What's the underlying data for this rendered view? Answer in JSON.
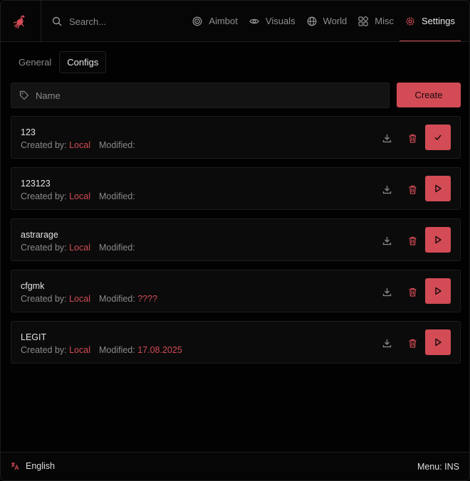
{
  "header": {
    "logo_icon": "crab-icon",
    "search_placeholder": "Search...",
    "nav": [
      {
        "label": "Aimbot",
        "icon": "target-icon"
      },
      {
        "label": "Visuals",
        "icon": "eye-icon"
      },
      {
        "label": "World",
        "icon": "globe-icon"
      },
      {
        "label": "Misc",
        "icon": "grid-icon"
      },
      {
        "label": "Settings",
        "icon": "gear-icon",
        "active": true
      }
    ]
  },
  "subtabs": [
    {
      "label": "General"
    },
    {
      "label": "Configs",
      "active": true
    }
  ],
  "name_input": {
    "placeholder": "Name",
    "value": ""
  },
  "create_label": "Create",
  "configs": [
    {
      "name": "123",
      "created_by_label": "Created by:",
      "created_by": "Local",
      "modified_label": "Modified:",
      "modified": "",
      "action": "check"
    },
    {
      "name": "123123",
      "created_by_label": "Created by:",
      "created_by": "Local",
      "modified_label": "Modified:",
      "modified": "",
      "action": "play"
    },
    {
      "name": "astrarage",
      "created_by_label": "Created by:",
      "created_by": "Local",
      "modified_label": "Modified:",
      "modified": "",
      "action": "play"
    },
    {
      "name": "cfgmk",
      "created_by_label": "Created by:",
      "created_by": "Local",
      "modified_label": "Modified:",
      "modified": "????",
      "action": "play"
    },
    {
      "name": "LEGIT",
      "created_by_label": "Created by:",
      "created_by": "Local",
      "modified_label": "Modified:",
      "modified": "17.08.2025",
      "action": "play"
    }
  ],
  "footer": {
    "language": "English",
    "menu_key": "Menu: INS"
  },
  "colors": {
    "accent": "#d24b55",
    "background": "#020202",
    "card": "#0b0b0b",
    "muted_text": "#8a8a8a"
  }
}
